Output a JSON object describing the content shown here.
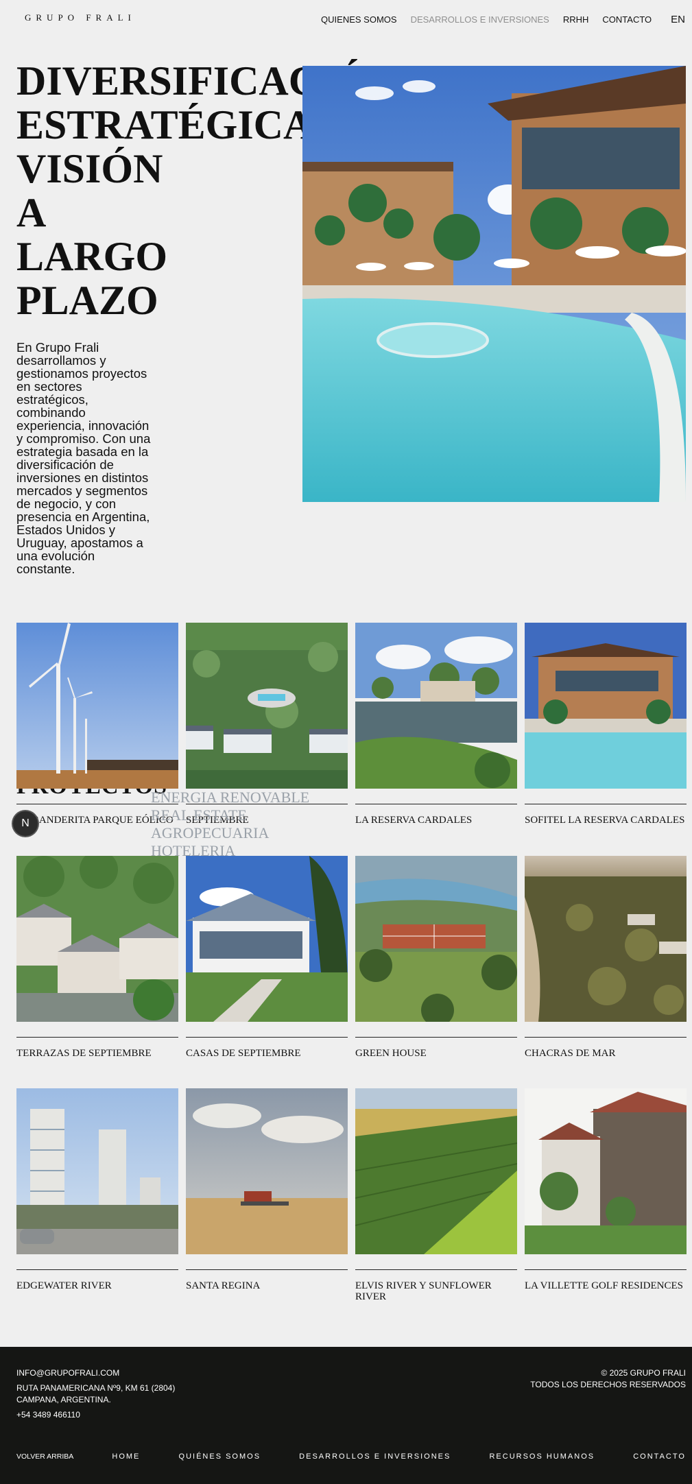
{
  "header": {
    "logo": "GRUPO FRALI",
    "nav": [
      "QUIENES SOMOS",
      "DESARROLLOS E INVERSIONES",
      "RRHH",
      "CONTACTO"
    ],
    "lang": "EN"
  },
  "hero": {
    "title_lines": [
      "DIVERSIFICACIÓN",
      "ESTRATÉGICA,",
      "VISIÓN",
      "A",
      "LARGO",
      "PLAZO"
    ],
    "body": "En Grupo Frali desarrollamos y gestionamos proyectos en sectores estratégicos, combinando experiencia, innovación y compromiso. Con una estrategia basada en la diversificación de inversiones en distintos mercados y segmentos de negocio, y con presencia en Argentina, Estados Unidos y Uruguay, apostamos a una evolución constante."
  },
  "projects": {
    "heading": "PROYECTOS",
    "categories": [
      "ENERGIA RENOVABLE",
      "REAL ESTATE",
      "AGROPECUARIA",
      "HOTELERIA"
    ],
    "filter_icon_label": "N",
    "items": [
      {
        "name": "LA BANDERITA PARQUE EÓLICO",
        "img": "wind"
      },
      {
        "name": "SEPTIEMBRE",
        "img": "aerial"
      },
      {
        "name": "LA RESERVA CARDALES",
        "img": "lake"
      },
      {
        "name": "SOFITEL LA RESERVA CARDALES",
        "img": "hotel"
      },
      {
        "name": "TERRAZAS DE SEPTIEMBRE",
        "img": "houses"
      },
      {
        "name": "CASAS DE SEPTIEMBRE",
        "img": "clubhouse"
      },
      {
        "name": "GREEN HOUSE",
        "img": "courts"
      },
      {
        "name": "CHACRAS DE MAR",
        "img": "dunes"
      },
      {
        "name": "EDGEWATER RIVER",
        "img": "towers"
      },
      {
        "name": "SANTA REGINA",
        "img": "harvest"
      },
      {
        "name": "ELVIS RIVER Y SUNFLOWER RIVER",
        "img": "fields"
      },
      {
        "name": "LA VILLETTE GOLF RESIDENCES",
        "img": "stone"
      }
    ]
  },
  "footer": {
    "email": "INFO@GRUPOFRALI.COM",
    "address_line1": "RUTA PANAMERICANA Nº9, KM 61 (2804)",
    "address_line2": "CAMPANA, ARGENTINA.",
    "phone": "+54 3489 466110",
    "copyright": "© 2025 GRUPO FRALI",
    "rights": "TODOS LOS DERECHOS RESERVADOS",
    "back_to_top": "VOLVER ARRIBA",
    "nav": [
      "HOME",
      "QUIÉNES SOMOS",
      "DESARROLLOS E INVERSIONES",
      "RECURSOS HUMANOS",
      "CONTACTO"
    ]
  }
}
